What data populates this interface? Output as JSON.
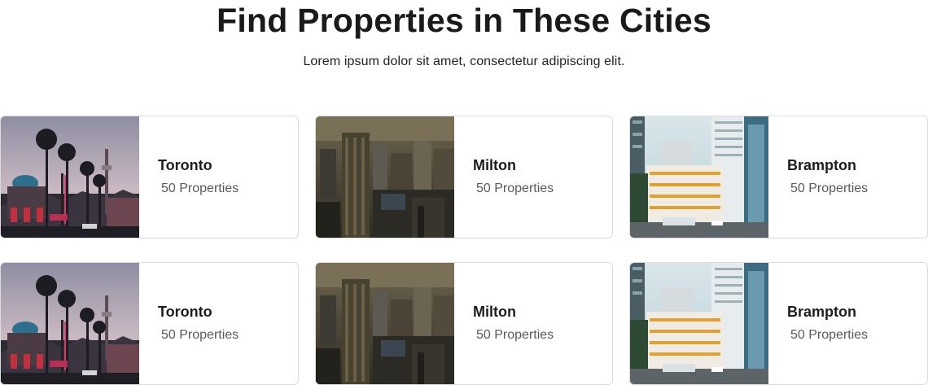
{
  "header": {
    "title": "Find Properties in These Cities",
    "subtitle": "Lorem ipsum dolor sit amet, consectetur adipiscing elit."
  },
  "cities": [
    {
      "name": "Toronto",
      "count": "50 Properties",
      "image": "toronto-street-photo"
    },
    {
      "name": "Milton",
      "count": "50 Properties",
      "image": "milton-aerial-city-photo"
    },
    {
      "name": "Brampton",
      "count": "50 Properties",
      "image": "brampton-buildings-photo"
    },
    {
      "name": "Toronto",
      "count": "50 Properties",
      "image": "toronto-street-photo"
    },
    {
      "name": "Milton",
      "count": "50 Properties",
      "image": "milton-aerial-city-photo"
    },
    {
      "name": "Brampton",
      "count": "50 Properties",
      "image": "brampton-buildings-photo"
    }
  ]
}
